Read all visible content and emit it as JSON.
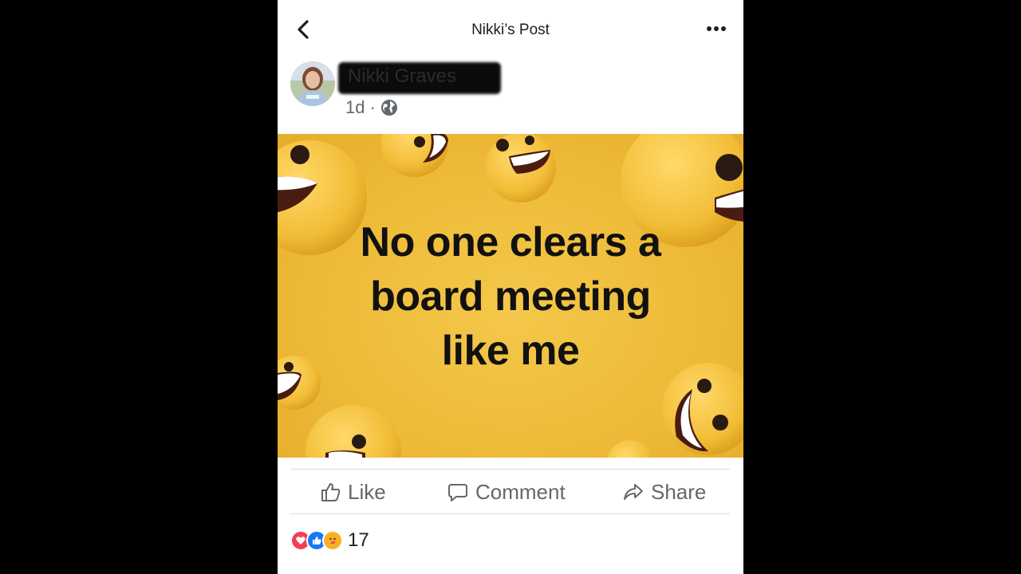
{
  "header": {
    "title": "Nikki’s Post",
    "back_icon": "chevron-left-icon",
    "more_icon": "more-horizontal-icon"
  },
  "post": {
    "author_name": "Nikki Graves",
    "time": "1d",
    "separator": "·",
    "audience_icon": "globe-icon",
    "image_text_lines": [
      "No one clears a",
      "board meeting",
      "like me"
    ],
    "image_background": "#eebb38"
  },
  "actions": {
    "like_label": "Like",
    "comment_label": "Comment",
    "share_label": "Share"
  },
  "reactions": {
    "icons": [
      "love-reaction-icon",
      "like-reaction-icon",
      "care-reaction-icon"
    ],
    "count": "17"
  },
  "colors": {
    "love": "#f33e58",
    "like": "#1877f2",
    "care": "#f7b125"
  }
}
